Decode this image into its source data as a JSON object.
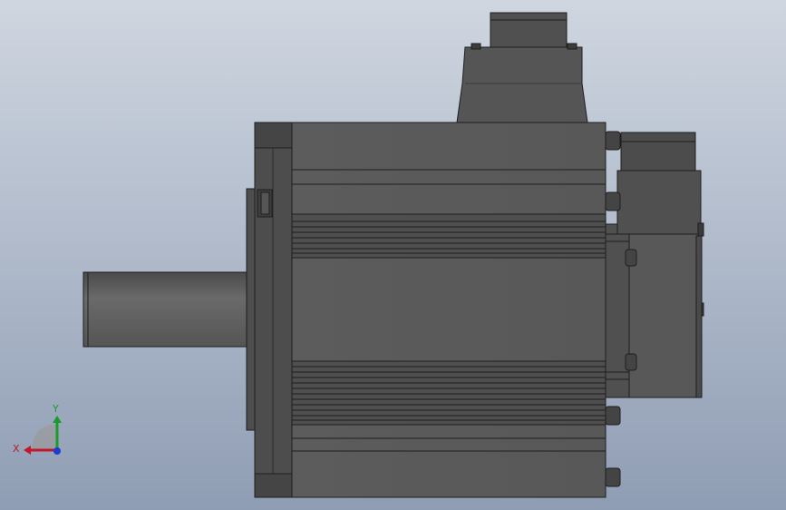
{
  "viewport": {
    "background_top": "#c9d1dd",
    "background_bottom": "#8e9cb4"
  },
  "model": {
    "body_color": "#5a5a5a",
    "dark_color": "#3c3c3c",
    "edge_color": "#1e1e1e",
    "light_color": "#6e6e6e"
  },
  "triad": {
    "x_label": "X",
    "y_label": "Y",
    "x_color": "#c0192a",
    "y_color": "#1a9b2a",
    "z_color": "#1a3fd0"
  }
}
